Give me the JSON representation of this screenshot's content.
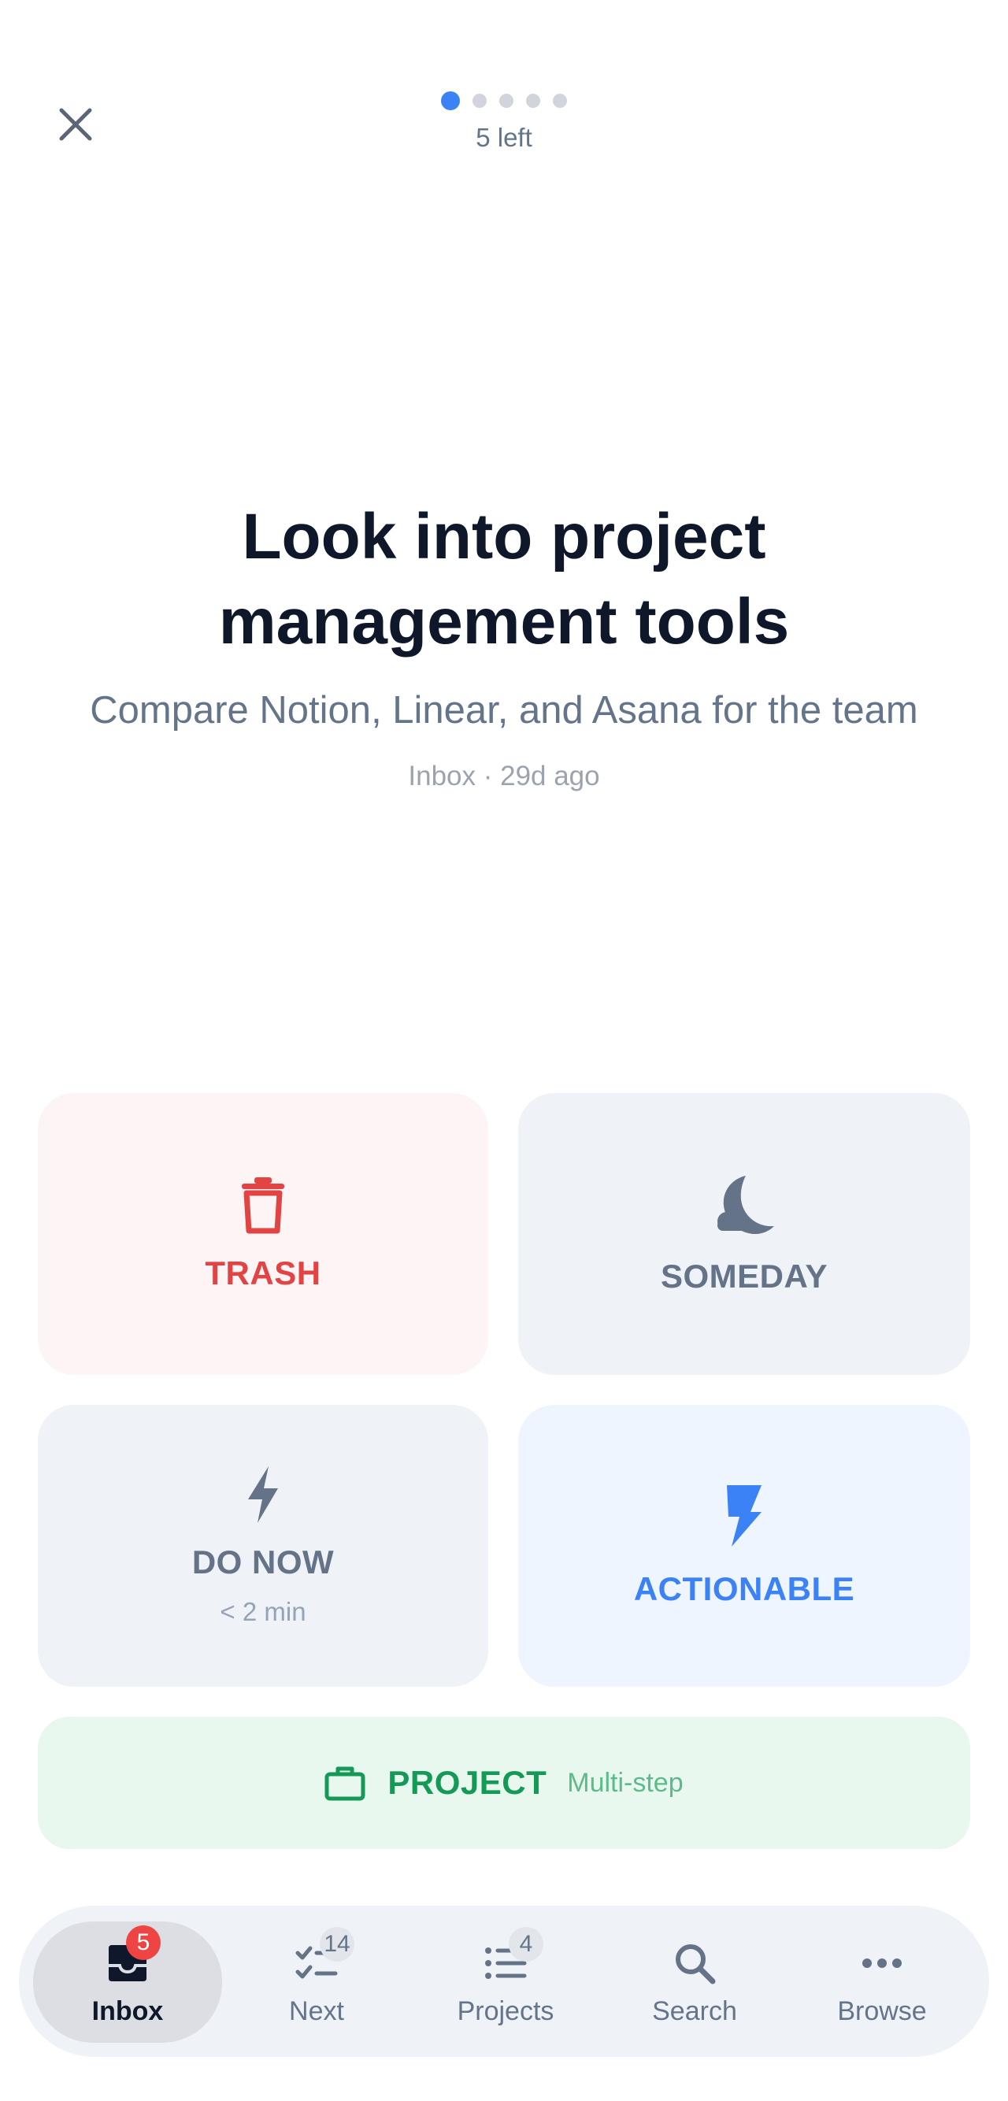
{
  "header": {
    "progress": {
      "total": 5,
      "current": 1
    },
    "remaining_label": "5 left"
  },
  "card": {
    "title": "Look into project management tools",
    "description": "Compare Notion, Linear, and Asana for the team",
    "meta": "Inbox · 29d ago"
  },
  "actions": {
    "trash": {
      "label": "TRASH",
      "icon": "trash-icon",
      "color": "#e24444"
    },
    "someday": {
      "label": "SOMEDAY",
      "icon": "moon-cloud-icon",
      "color": "#647387"
    },
    "do_now": {
      "label": "DO NOW",
      "sublabel": "< 2 min",
      "icon": "bolt-icon",
      "color": "#647387"
    },
    "actionable": {
      "label": "ACTIONABLE",
      "icon": "bolt-filled-icon",
      "color": "#3b82f6"
    },
    "project": {
      "label": "PROJECT",
      "sublabel": "Multi-step",
      "icon": "briefcase-icon",
      "color": "#159957"
    }
  },
  "nav": {
    "items": [
      {
        "label": "Inbox",
        "icon": "inbox-icon",
        "badge": "5",
        "active": true
      },
      {
        "label": "Next",
        "icon": "checklist-icon",
        "badge": "14"
      },
      {
        "label": "Projects",
        "icon": "list-icon",
        "badge": "4"
      },
      {
        "label": "Search",
        "icon": "search-icon"
      },
      {
        "label": "Browse",
        "icon": "more-icon"
      }
    ]
  }
}
